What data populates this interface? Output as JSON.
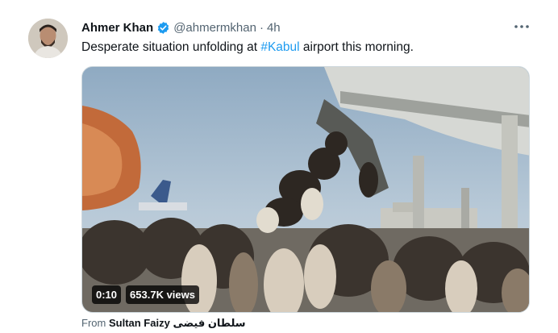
{
  "author": {
    "name": "Ahmer Khan",
    "handle": "@ahmermkhan",
    "separator": "·",
    "time": "4h"
  },
  "tweet": {
    "text_before": "Desperate situation unfolding at ",
    "hashtag": "#Kabul",
    "text_after": " airport this morning."
  },
  "video": {
    "duration": "0:10",
    "views": "653.7K views"
  },
  "source": {
    "prefix": "From",
    "name": "Sultan Faizy سلطان فیضی"
  },
  "icons": {
    "verified": "verified-badge-icon",
    "more": "more-options-icon"
  },
  "colors": {
    "accent": "#1d9bf0",
    "secondary_text": "#536471",
    "primary_text": "#0f1419"
  }
}
